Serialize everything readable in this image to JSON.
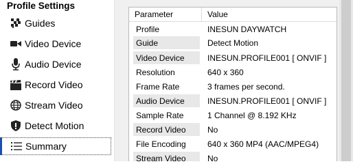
{
  "sidebar": {
    "title": "Profile Settings",
    "items": [
      {
        "label": "Guides",
        "icon": "checkered-icon"
      },
      {
        "label": "Video Device",
        "icon": "video-camera-icon"
      },
      {
        "label": "Audio Device",
        "icon": "microphone-icon"
      },
      {
        "label": "Record Video",
        "icon": "clapperboard-icon"
      },
      {
        "label": "Stream Video",
        "icon": "globe-icon"
      },
      {
        "label": "Detect Motion",
        "icon": "shield-icon"
      },
      {
        "label": "Summary",
        "icon": "list-icon"
      }
    ],
    "selected": "Summary"
  },
  "summary": {
    "columns": [
      "Parameter",
      "Value"
    ],
    "rows": [
      {
        "param": "Profile",
        "value": "INESUN DAYWATCH"
      },
      {
        "param": "Guide",
        "value": "Detect Motion"
      },
      {
        "param": "Video Device",
        "value": "INESUN.PROFILE001 [ ONVIF ]"
      },
      {
        "param": "Resolution",
        "value": "640 x 360"
      },
      {
        "param": "Frame Rate",
        "value": "3 frames per second."
      },
      {
        "param": "Audio Device",
        "value": "INESUN.PROFILE001 [ ONVIF ]"
      },
      {
        "param": "Sample Rate",
        "value": "1 Channel @ 8.192 KHz"
      },
      {
        "param": "Record Video",
        "value": "No"
      },
      {
        "param": "File Encoding",
        "value": "640 x 360 MP4 (AAC/MPEG4)"
      },
      {
        "param": "Stream Video",
        "value": "No"
      }
    ]
  }
}
